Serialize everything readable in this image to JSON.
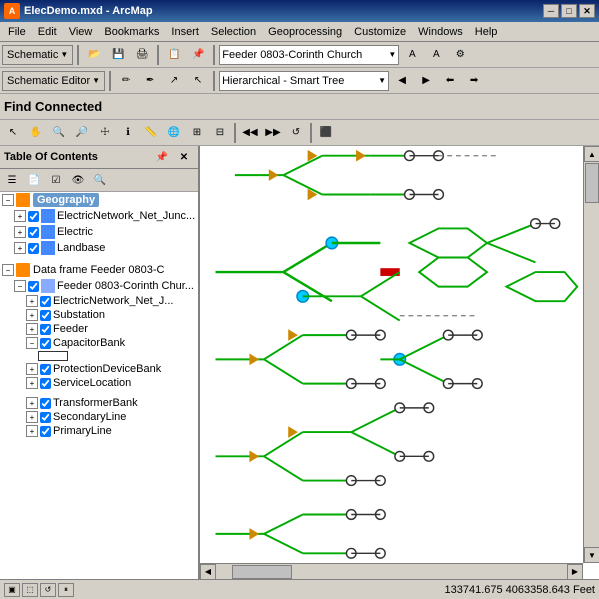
{
  "titlebar": {
    "title": "ElecDemo.mxd - ArcMap",
    "min_btn": "─",
    "max_btn": "□",
    "close_btn": "✕"
  },
  "menu": {
    "items": [
      "File",
      "Edit",
      "View",
      "Bookmarks",
      "Insert",
      "Selection",
      "Geoprocessing",
      "Customize",
      "Windows",
      "Help"
    ]
  },
  "toolbar1": {
    "schematic_label": "Schematic",
    "dropdown_value": "Feeder 0803-Corinth Church",
    "dropdown_arrow": "▼"
  },
  "toolbar2": {
    "schematic_editor_label": "Schematic Editor",
    "dropdown_value": "Hierarchical - Smart Tree",
    "dropdown_arrow": "▼"
  },
  "find_connected": {
    "label": "Find Connected"
  },
  "toc": {
    "header": "Table Of Contents",
    "close_btn": "✕",
    "pin_btn": "📌",
    "geography_group": "Geography",
    "layers": [
      "ElectricNetwork_Net_Junc...",
      "Electric",
      "Landbase"
    ],
    "dataframe_label": "Data frame Feeder 0803-C",
    "dataframe_layers": [
      "Feeder 0803-Corinth Chur...",
      "ElectricNetwork_Net_J...",
      "Substation",
      "Feeder",
      "CapacitorBank",
      "ProtectionDeviceBank",
      "ServiceLocation",
      "TransformerBank",
      "SecondaryLine",
      "PrimaryLine"
    ]
  },
  "statusbar": {
    "coordinates": "133741.675  4063358.643 Feet"
  },
  "map": {
    "background_color": "#ffffff",
    "line_color_green": "#00cc00",
    "line_color_dark": "#333333",
    "line_color_dashed": "#888888",
    "node_color_white": "#ffffff",
    "node_color_cyan": "#00ccff",
    "node_color_red": "#cc0000",
    "triangle_color": "#cc8800"
  }
}
